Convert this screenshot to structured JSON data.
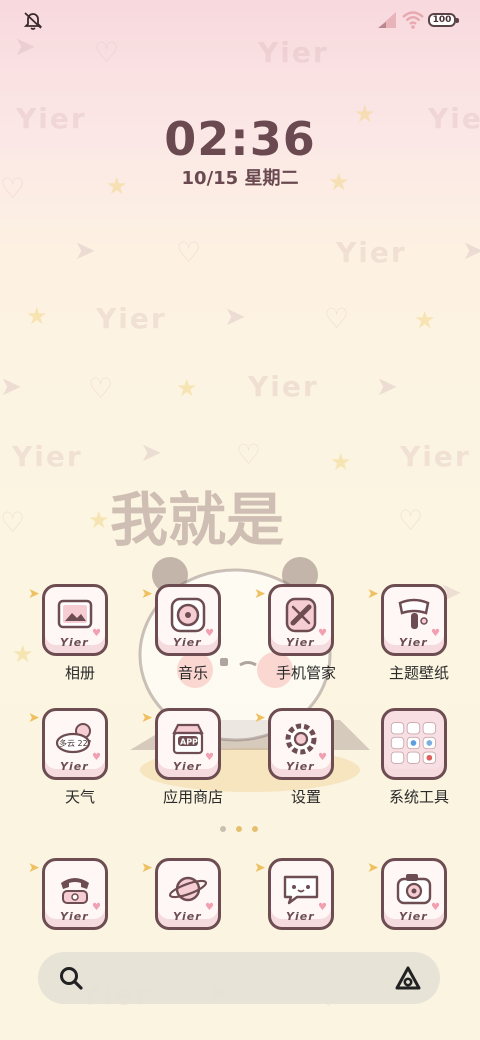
{
  "status_bar": {
    "battery": "100",
    "icons": [
      "mute-icon",
      "signal-icon",
      "wifi-icon",
      "battery-icon"
    ]
  },
  "lockclock": {
    "time": "02:36",
    "date": "10/15  星期二"
  },
  "wallpaper": {
    "watermark": "Yier",
    "center_text_line1": "我就是"
  },
  "apps": [
    {
      "label": "相册",
      "badge": "Yier",
      "icon": "photo-album-icon"
    },
    {
      "label": "音乐",
      "badge": "Yier",
      "icon": "music-record-icon"
    },
    {
      "label": "手机管家",
      "badge": "Yier",
      "icon": "phone-manager-icon"
    },
    {
      "label": "主题壁纸",
      "badge": "Yier",
      "icon": "theme-brush-icon"
    },
    {
      "label": "天气",
      "badge": "Yier",
      "icon": "weather-icon",
      "weather_text": "多云 22°"
    },
    {
      "label": "应用商店",
      "badge": "Yier",
      "icon": "app-store-icon",
      "store_text": "APP"
    },
    {
      "label": "设置",
      "badge": "Yier",
      "icon": "settings-gear-icon"
    },
    {
      "label": "系统工具",
      "badge": "",
      "icon": "system-tools-folder-icon"
    }
  ],
  "dock": [
    {
      "badge": "Yier",
      "icon": "phone-icon"
    },
    {
      "badge": "Yier",
      "icon": "browser-planet-icon"
    },
    {
      "badge": "Yier",
      "icon": "messages-icon"
    },
    {
      "badge": "Yier",
      "icon": "camera-icon"
    }
  ],
  "colors": {
    "outline": "#6d4d52",
    "accent_yellow": "#f0c060",
    "accent_pink": "#f0a0b0",
    "bg_top": "#f8d9de",
    "bg_bottom": "#faf4e0"
  }
}
